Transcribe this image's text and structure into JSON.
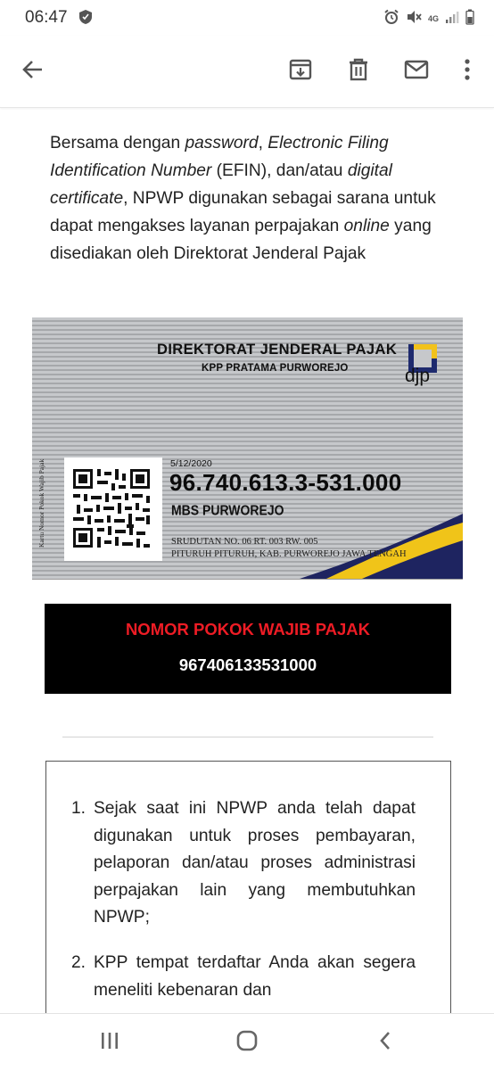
{
  "status_bar": {
    "time": "06:47",
    "network": "4G"
  },
  "toolbar": {
    "back_icon": "arrow-back-icon",
    "archive_icon": "archive-icon",
    "delete_icon": "trash-icon",
    "mark_unread_icon": "mail-icon",
    "more_icon": "more-vertical-icon"
  },
  "email": {
    "intro_segments": [
      {
        "text": "Bersama dengan ",
        "italic": false
      },
      {
        "text": "password",
        "italic": true
      },
      {
        "text": ", ",
        "italic": false
      },
      {
        "text": "Electronic Filing Identification Number",
        "italic": true
      },
      {
        "text": " (EFIN), dan/atau ",
        "italic": false
      },
      {
        "text": "digital certificate",
        "italic": true
      },
      {
        "text": ", NPWP digunakan sebagai sarana untuk dapat mengakses layanan perpajakan ",
        "italic": false
      },
      {
        "text": "online",
        "italic": true
      },
      {
        "text": " yang disediakan oleh Direktorat Jenderal Pajak",
        "italic": false
      }
    ],
    "card": {
      "institution": "DIREKTORAT JENDERAL PAJAK",
      "office": "KPP PRATAMA PURWOREJO",
      "logo_text": "djp",
      "side_label": "Kartu Nomor Pokok Wajib Pajak",
      "date": "5/12/2020",
      "npwp": "96.740.613.3-531.000",
      "name": "MBS PURWOREJO",
      "address_line1": "SRUDUTAN NO. 06 RT. 003 RW. 005",
      "address_line2": "PITURUH PITURUH, KAB. PURWOREJO JAWA TENGAH",
      "colors": {
        "logo_blue": "#1e2a6e",
        "logo_gold": "#f2c21b",
        "swoosh_navy": "#1e2460",
        "swoosh_gold": "#f0c419"
      }
    },
    "banner": {
      "title": "NOMOR POKOK WAJIB PAJAK",
      "number": "967406133531000",
      "colors": {
        "background": "#000000",
        "title": "#ee1c25",
        "number": "#ffffff"
      }
    },
    "notice_items": [
      {
        "num": "1.",
        "text": "Sejak saat ini NPWP anda telah dapat digunakan untuk proses pembayaran, pelaporan dan/atau proses administrasi perpajakan lain yang membutuhkan NPWP;"
      },
      {
        "num": "2.",
        "text": "KPP tempat terdaftar Anda akan segera meneliti kebenaran dan"
      }
    ]
  },
  "navbar": {
    "recents_icon": "recents-icon",
    "home_icon": "home-icon",
    "back_icon": "back-chevron-icon"
  }
}
